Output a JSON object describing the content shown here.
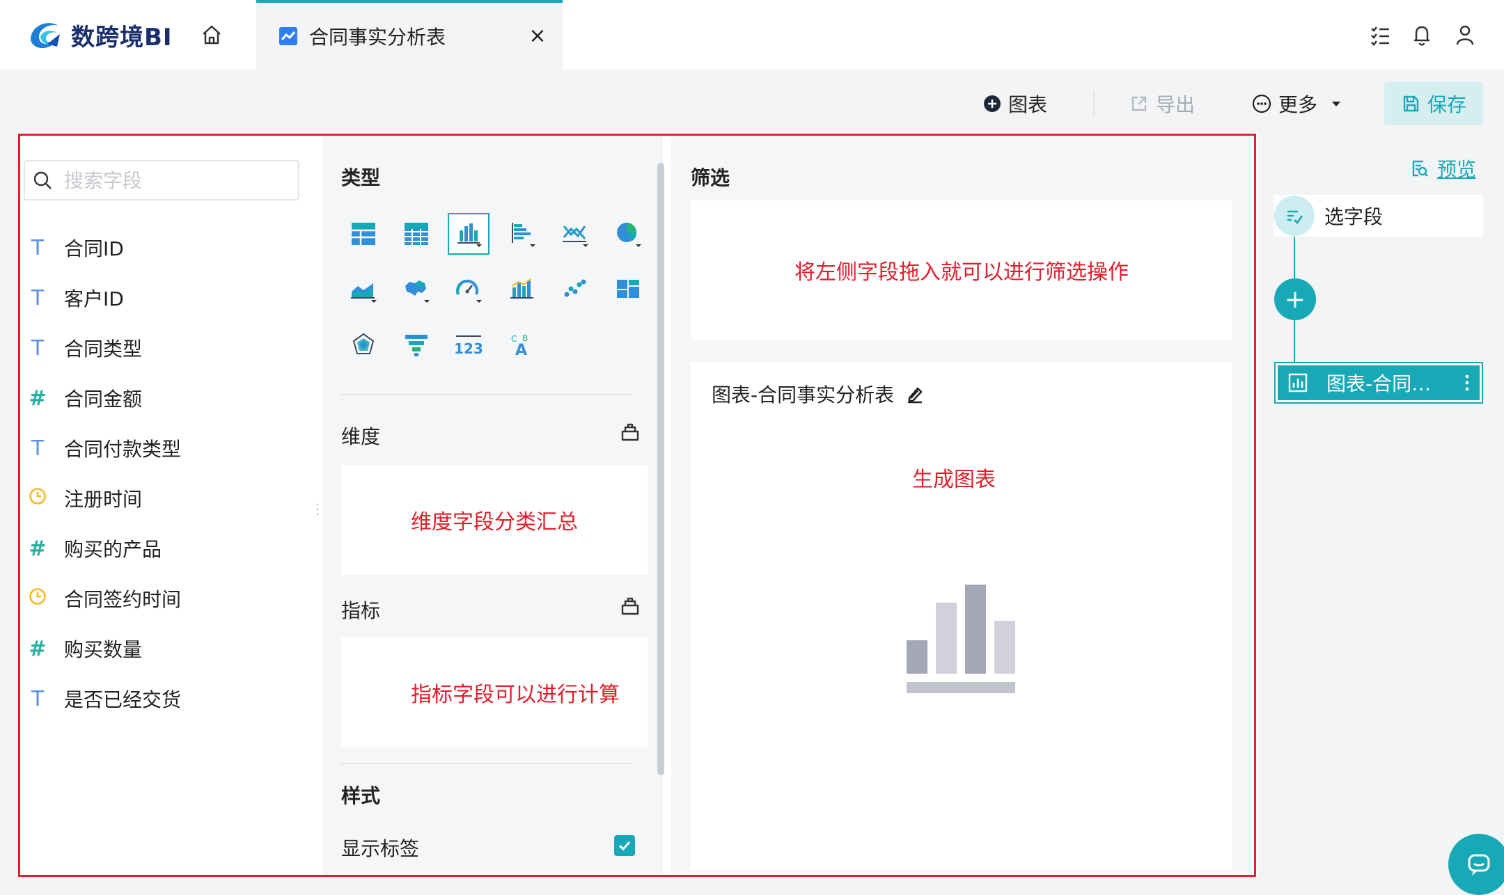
{
  "app": {
    "brand": "数跨境BI",
    "tab_title": "合同事实分析表",
    "tab_close": "×"
  },
  "toolbar": {
    "chart_label": "图表",
    "export_label": "导出",
    "more_label": "更多",
    "save_label": "保存",
    "preview_label": "预览"
  },
  "fields": {
    "search_placeholder": "搜索字段",
    "items": [
      {
        "type": "T",
        "label": "合同ID"
      },
      {
        "type": "T",
        "label": "客户ID"
      },
      {
        "type": "T",
        "label": "合同类型"
      },
      {
        "type": "#",
        "label": "合同金额"
      },
      {
        "type": "T",
        "label": "合同付款类型"
      },
      {
        "type": "clock",
        "label": "注册时间"
      },
      {
        "type": "#",
        "label": "购买的产品"
      },
      {
        "type": "clock",
        "label": "合同签约时间"
      },
      {
        "type": "#",
        "label": "购买数量"
      },
      {
        "type": "T",
        "label": "是否已经交货"
      }
    ]
  },
  "config": {
    "type_title": "类型",
    "dimension_title": "维度",
    "dimension_hint": "维度字段分类汇总",
    "metric_title": "指标",
    "metric_hint": "指标字段可以进行计算",
    "style_title": "样式",
    "show_label": "显示标签",
    "show_label_checked": true,
    "chart_types": [
      "table-icon",
      "cross-table-icon",
      "bar-chart-icon",
      "horizontal-bar-icon",
      "line-chart-icon",
      "pie-chart-icon",
      "area-chart-icon",
      "map-icon",
      "gauge-icon",
      "combo-chart-icon",
      "scatter-icon",
      "treemap-icon",
      "radar-icon",
      "funnel-icon",
      "kpi-number-icon",
      "word-cloud-icon"
    ],
    "selected_chart_type": "bar-chart-icon"
  },
  "canvas": {
    "filter_title": "筛选",
    "filter_hint": "将左侧字段拖入就可以进行筛选操作",
    "chart_title": "图表-合同事实分析表",
    "chart_hint": "生成图表"
  },
  "flow": {
    "step_label": "选字段",
    "add_label": "+",
    "chart_node_label": "图表-合同…"
  },
  "colors": {
    "accent": "#17a9b5",
    "annotation_red": "#e31e2b",
    "field_text_icon": "#5b8fe6",
    "field_number_icon": "#26b0a0",
    "field_time_icon": "#f5b820"
  }
}
